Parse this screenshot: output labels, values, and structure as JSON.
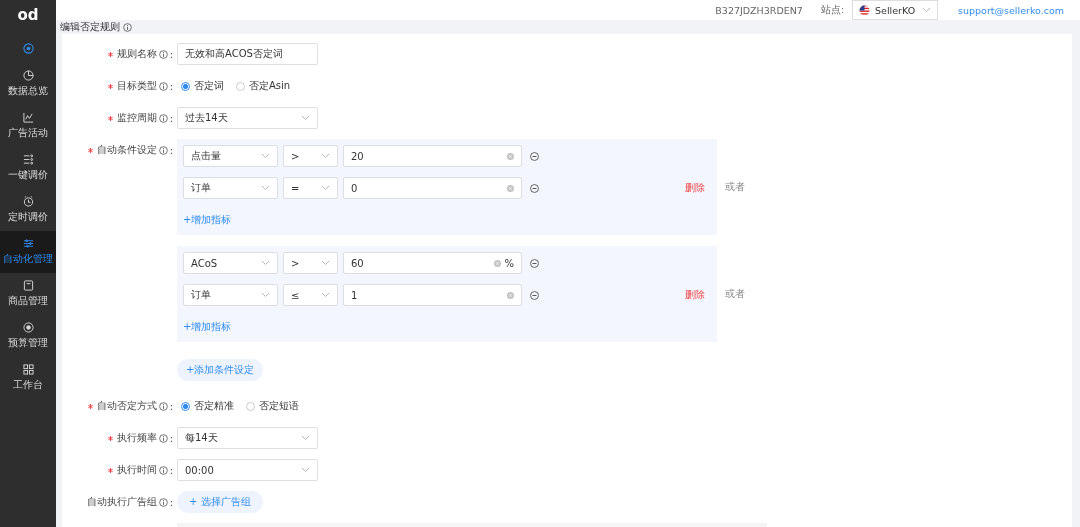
{
  "sidebar": {
    "logo": "od",
    "items": [
      {
        "label": "数据总览",
        "selected": false
      },
      {
        "label": "广告活动",
        "selected": false
      },
      {
        "label": "一键调价",
        "selected": false
      },
      {
        "label": "定时调价",
        "selected": false
      },
      {
        "label": "自动化管理",
        "selected": true
      },
      {
        "label": "商品管理",
        "selected": false
      },
      {
        "label": "预算管理",
        "selected": false
      },
      {
        "label": "工作台",
        "selected": false
      }
    ]
  },
  "header": {
    "account_id": "B327JDZH3RDEN7",
    "site_label": "站点:",
    "site_value": "SellerKO",
    "support_link": "support@sellerko.com"
  },
  "page_title": "编辑否定规则",
  "label_colon": ":",
  "fields": [
    {
      "kind": "text",
      "label": "规则名称",
      "required": true,
      "value": "无效和高ACOS否定词"
    },
    {
      "kind": "radio",
      "label": "目标类型",
      "required": true,
      "options": [
        {
          "label": "否定词",
          "selected": true
        },
        {
          "label": "否定Asin",
          "selected": false
        }
      ]
    },
    {
      "kind": "select",
      "label": "监控周期",
      "required": true,
      "value": "过去14天"
    },
    {
      "kind": "conditions",
      "label": "自动条件设定",
      "required": true,
      "add_group_label": "+添加条件设定",
      "groups": [
        {
          "add_label": "+增加指标",
          "delete_label": "删除",
          "or_label": "或者",
          "rows": [
            {
              "metric": "点击量",
              "operator": ">",
              "value": "20"
            },
            {
              "metric": "订单",
              "operator": "=",
              "value": "0"
            }
          ]
        },
        {
          "add_label": "+增加指标",
          "delete_label": "删除",
          "or_label": "或者",
          "rows": [
            {
              "metric": "ACoS",
              "operator": ">",
              "value": "60",
              "unit": "%"
            },
            {
              "metric": "订单",
              "operator": "≤",
              "value": "1"
            }
          ]
        }
      ]
    },
    {
      "kind": "radio",
      "label": "自动否定方式",
      "required": true,
      "options": [
        {
          "label": "否定精准",
          "selected": true
        },
        {
          "label": "否定短语",
          "selected": false
        }
      ]
    },
    {
      "kind": "select",
      "label": "执行频率",
      "required": true,
      "value": "每14天"
    },
    {
      "kind": "select",
      "label": "执行时间",
      "required": true,
      "value": "00:00"
    },
    {
      "kind": "button",
      "label": "自动执行广告组",
      "required": false,
      "button": "+ 选择广告组"
    }
  ]
}
